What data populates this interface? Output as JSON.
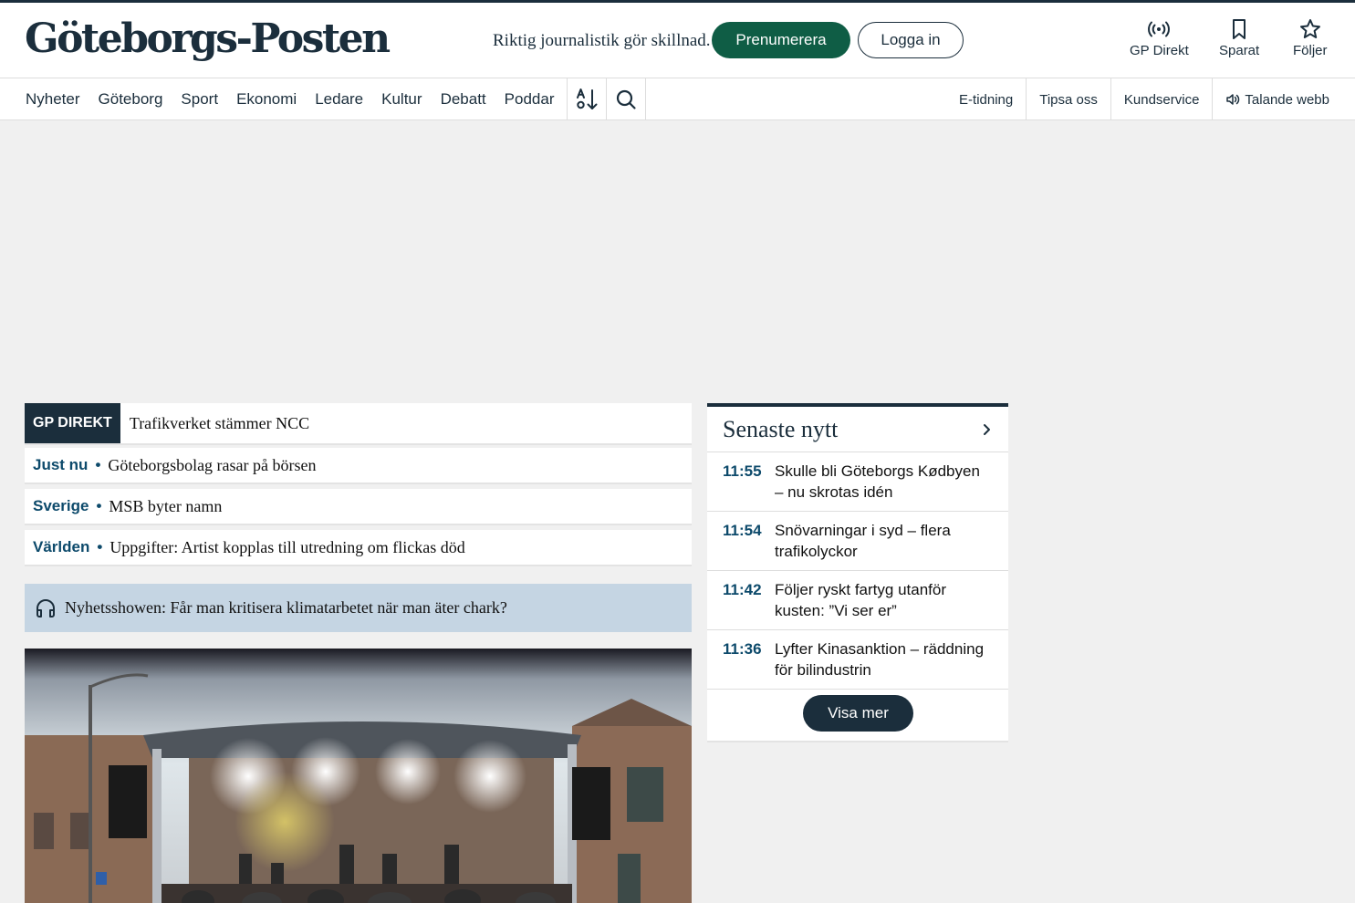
{
  "header": {
    "logo": "Göteborgs-Posten",
    "tagline": "Riktig journalistik gör skillnad.",
    "subscribe_label": "Prenumerera",
    "login_label": "Logga in",
    "actions": [
      {
        "label": "GP Direkt",
        "icon": "broadcast-icon"
      },
      {
        "label": "Sparat",
        "icon": "bookmark-icon"
      },
      {
        "label": "Följer",
        "icon": "star-icon"
      }
    ]
  },
  "nav": {
    "items": [
      "Nyheter",
      "Göteborg",
      "Sport",
      "Ekonomi",
      "Ledare",
      "Kultur",
      "Debatt",
      "Poddar"
    ],
    "tools": [
      "sort-icon",
      "search-icon"
    ],
    "right": [
      "E-tidning",
      "Tipsa oss",
      "Kundservice",
      "Talande webb"
    ]
  },
  "gp_direkt": {
    "badge": "GP DIREKT",
    "headline": "Trafikverket stämmer NCC"
  },
  "briefs": [
    {
      "category": "Just nu",
      "text": "Göteborgsbolag rasar på börsen"
    },
    {
      "category": "Sverige",
      "text": "MSB byter namn"
    },
    {
      "category": "Världen",
      "text": "Uppgifter: Artist kopplas till utredning om flickas död"
    }
  ],
  "podcast": {
    "icon": "headphones-icon",
    "text": "Nyhetsshowen: Får man kritisera klimatarbetet när man äter chark?"
  },
  "latest": {
    "title": "Senaste nytt",
    "items": [
      {
        "time": "11:55",
        "text": "Skulle bli Göteborgs Kødbyen – nu skrotas idén"
      },
      {
        "time": "11:54",
        "text": "Snövarningar i syd – flera trafikolyckor"
      },
      {
        "time": "11:42",
        "text": "Följer ryskt fartyg utanför kusten: ”Vi ser er”"
      },
      {
        "time": "11:36",
        "text": "Lyfter Kinasanktion – räddning för bilindustrin"
      }
    ],
    "more_label": "Visa mer"
  },
  "colors": {
    "brand_dark": "#1b2e3c",
    "subscribe_green": "#0f5d45",
    "category_blue": "#0d4a6b",
    "podcast_bg": "#c5d5e3"
  }
}
